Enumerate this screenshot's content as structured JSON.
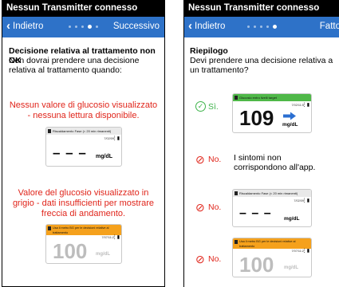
{
  "left": {
    "status_title": "Nessun Transmitter connesso",
    "nav": {
      "back_label": "Indietro",
      "next_label": "Successivo",
      "active_dot": 4
    },
    "heading": "Decisione relativa al trattamento non OK",
    "intro": "Non dovrai prendere una decisione relativa al trattamento quando:",
    "case1_text": "Nessun valore di glucosio visualizzato - nessuna lettura disponibile.",
    "case1_screen": {
      "bar_text": "Riscaldamento Fase (< 20 min rimanenti)",
      "time": "7/02/09",
      "value": "– – –",
      "unit": "mg/dL"
    },
    "case2_text": "Valore del glucosio visualizzato in grigio - dati insufficienti per mostrare freccia di andamento.",
    "case2_screen": {
      "bar_text": "Usa il metro BG per le decisioni relative al trattamento",
      "time": "7/07/11:2",
      "value": "100",
      "unit": "mg/dL"
    }
  },
  "right": {
    "status_title": "Nessun Transmitter connesso",
    "nav": {
      "back_label": "Indietro",
      "next_label": "Fatto",
      "active_dot": 5
    },
    "heading": "Riepilogo",
    "intro": "Devi prendere una decisione relativa a un trattamento?",
    "rows": [
      {
        "answer": "Sì.",
        "screen": {
          "bar_text": "Glucosio entro livelli target",
          "time": "7/02/11:5",
          "value": "109",
          "unit": "mg/dL"
        }
      },
      {
        "answer": "No.",
        "text": "I sintomi non corrispondono all'app."
      },
      {
        "answer": "No.",
        "screen": {
          "bar_text": "Riscaldamento Fase (< 20 min rimanenti)",
          "time": "7/02/09",
          "value": "– – –",
          "unit": "mg/dL"
        }
      },
      {
        "answer": "No.",
        "screen": {
          "bar_text": "Usa il metro BG per le decisioni relative al trattamento",
          "time": "7/07/11:2",
          "value": "100",
          "unit": "mg/dL"
        }
      }
    ]
  },
  "colors": {
    "nav_blue": "#2e72c8",
    "warning_red": "#e0251b",
    "ok_green": "#3db34a",
    "bar_green": "#4fb848",
    "bar_orange": "#f5a11c",
    "trend_blue": "#2b6fd1",
    "grey_value": "#bdbdbd"
  },
  "icons": {
    "back": "chevron-left-icon",
    "yes": "check-circle-icon",
    "no": "no-entry-icon",
    "arrow": "arrow-right-icon"
  }
}
